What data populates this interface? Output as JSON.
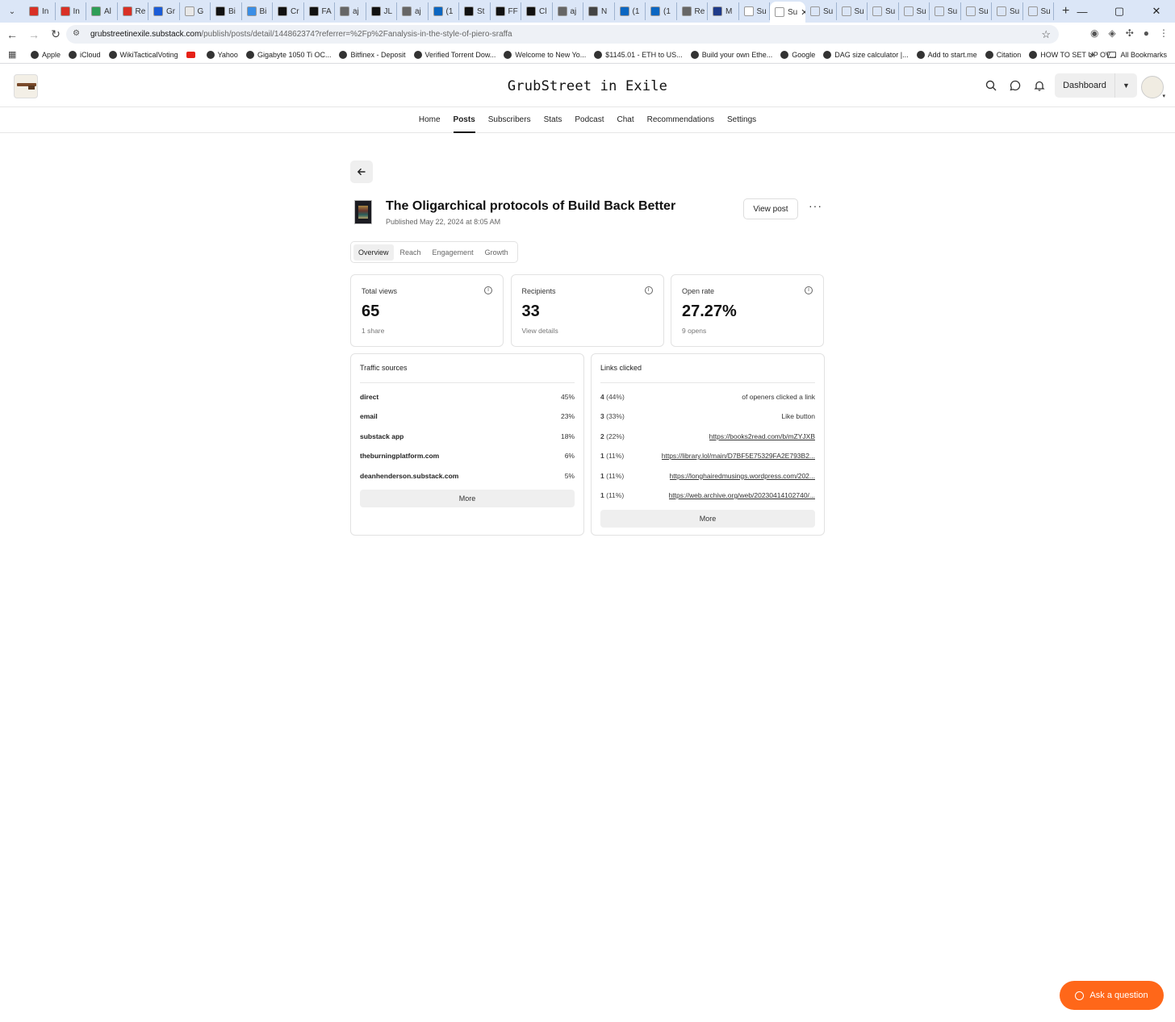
{
  "browser": {
    "tabs": [
      {
        "label": "In",
        "fav": "#d93025"
      },
      {
        "label": "In",
        "fav": "#d93025"
      },
      {
        "label": "Al",
        "fav": "#2e9e57"
      },
      {
        "label": "Re",
        "fav": "#d93025"
      },
      {
        "label": "Gr",
        "fav": "#1a5cd8"
      },
      {
        "label": "G",
        "fav": "#e8e8e8"
      },
      {
        "label": "Bi",
        "fav": "#111111"
      },
      {
        "label": "Bi",
        "fav": "#3a8ee6"
      },
      {
        "label": "Cr",
        "fav": "#111111"
      },
      {
        "label": "FA",
        "fav": "#111111"
      },
      {
        "label": "aj",
        "fav": "#666666"
      },
      {
        "label": "JL",
        "fav": "#111111"
      },
      {
        "label": "aj",
        "fav": "#666666"
      },
      {
        "label": "(1",
        "fav": "#0a66c2"
      },
      {
        "label": "St",
        "fav": "#111111"
      },
      {
        "label": "FF",
        "fav": "#111111"
      },
      {
        "label": "Cl",
        "fav": "#111111"
      },
      {
        "label": "aj",
        "fav": "#666666"
      },
      {
        "label": "N",
        "fav": "#444444"
      },
      {
        "label": "(1",
        "fav": "#0a66c2"
      },
      {
        "label": "(1",
        "fav": "#0a66c2"
      },
      {
        "label": "Re",
        "fav": "#666666"
      },
      {
        "label": "M",
        "fav": "#1e3a8a"
      },
      {
        "label": "Su",
        "fav": "#ffffff"
      }
    ],
    "active_tab": {
      "label": "Su"
    },
    "tabs_after": [
      {
        "label": "Su"
      },
      {
        "label": "Su"
      },
      {
        "label": "Su"
      },
      {
        "label": "Su"
      },
      {
        "label": "Su"
      },
      {
        "label": "Su"
      },
      {
        "label": "Su"
      },
      {
        "label": "Su"
      }
    ],
    "url_host": "grubstreetinexile.substack.com",
    "url_path": "/publish/posts/detail/144862374?referrer=%2Fp%2Fanalysis-in-the-style-of-piero-sraffa",
    "bookmarks": [
      {
        "label": "Apple"
      },
      {
        "label": "iCloud"
      },
      {
        "label": "WikiTacticalVoting"
      },
      {
        "label": ""
      },
      {
        "label": "Yahoo"
      },
      {
        "label": "Gigabyte 1050 Ti OC..."
      },
      {
        "label": "Bitfinex - Deposit"
      },
      {
        "label": "Verified Torrent Dow..."
      },
      {
        "label": "Welcome to New Yo..."
      },
      {
        "label": "$1145.01 - ETH to US..."
      },
      {
        "label": "Build your own Ethe..."
      },
      {
        "label": "Google"
      },
      {
        "label": "DAG size calculator |..."
      },
      {
        "label": "Add to start.me"
      },
      {
        "label": "Citation"
      },
      {
        "label": "HOW TO SET UP OV..."
      }
    ],
    "all_bookmarks": "All Bookmarks"
  },
  "site": {
    "title": "GrubStreet in Exile",
    "dashboard_label": "Dashboard",
    "nav": [
      {
        "label": "Home"
      },
      {
        "label": "Posts"
      },
      {
        "label": "Subscribers"
      },
      {
        "label": "Stats"
      },
      {
        "label": "Podcast"
      },
      {
        "label": "Chat"
      },
      {
        "label": "Recommendations"
      },
      {
        "label": "Settings"
      }
    ],
    "active_nav": "Posts"
  },
  "post": {
    "title": "The Oligarchical protocols of Build Back Better",
    "published": "Published May 22, 2024 at 8:05 AM",
    "view_post_label": "View post",
    "tabs": [
      {
        "label": "Overview"
      },
      {
        "label": "Reach"
      },
      {
        "label": "Engagement"
      },
      {
        "label": "Growth"
      }
    ],
    "active_tab": "Overview"
  },
  "stats": [
    {
      "label": "Total views",
      "value": "65",
      "sub": "1 share"
    },
    {
      "label": "Recipients",
      "value": "33",
      "sub": "View details"
    },
    {
      "label": "Open rate",
      "value": "27.27%",
      "sub": "9 opens"
    }
  ],
  "traffic": {
    "title": "Traffic sources",
    "rows": [
      {
        "source": "direct",
        "pct": "45%"
      },
      {
        "source": "email",
        "pct": "23%"
      },
      {
        "source": "substack app",
        "pct": "18%"
      },
      {
        "source": "theburningplatform.com",
        "pct": "6%"
      },
      {
        "source": "deanhenderson.substack.com",
        "pct": "5%"
      }
    ],
    "more_label": "More"
  },
  "links": {
    "title": "Links clicked",
    "rows": [
      {
        "count": "4",
        "pct": "(44%)",
        "target": "of openers clicked a link",
        "is_link": false
      },
      {
        "count": "3",
        "pct": "(33%)",
        "target": "Like button",
        "is_link": false
      },
      {
        "count": "2",
        "pct": "(22%)",
        "target": "https://books2read.com/b/mZYJXB",
        "is_link": true
      },
      {
        "count": "1",
        "pct": "(11%)",
        "target": "https://library.lol/main/D7BF5E75329FA2E793B2...",
        "is_link": true
      },
      {
        "count": "1",
        "pct": "(11%)",
        "target": "https://longhairedmusings.wordpress.com/202...",
        "is_link": true
      },
      {
        "count": "1",
        "pct": "(11%)",
        "target": "https://web.archive.org/web/20230414102740/...",
        "is_link": true
      }
    ],
    "more_label": "More"
  },
  "ask": {
    "label": "Ask a question"
  },
  "colors": {
    "accent": "#ff6719"
  }
}
